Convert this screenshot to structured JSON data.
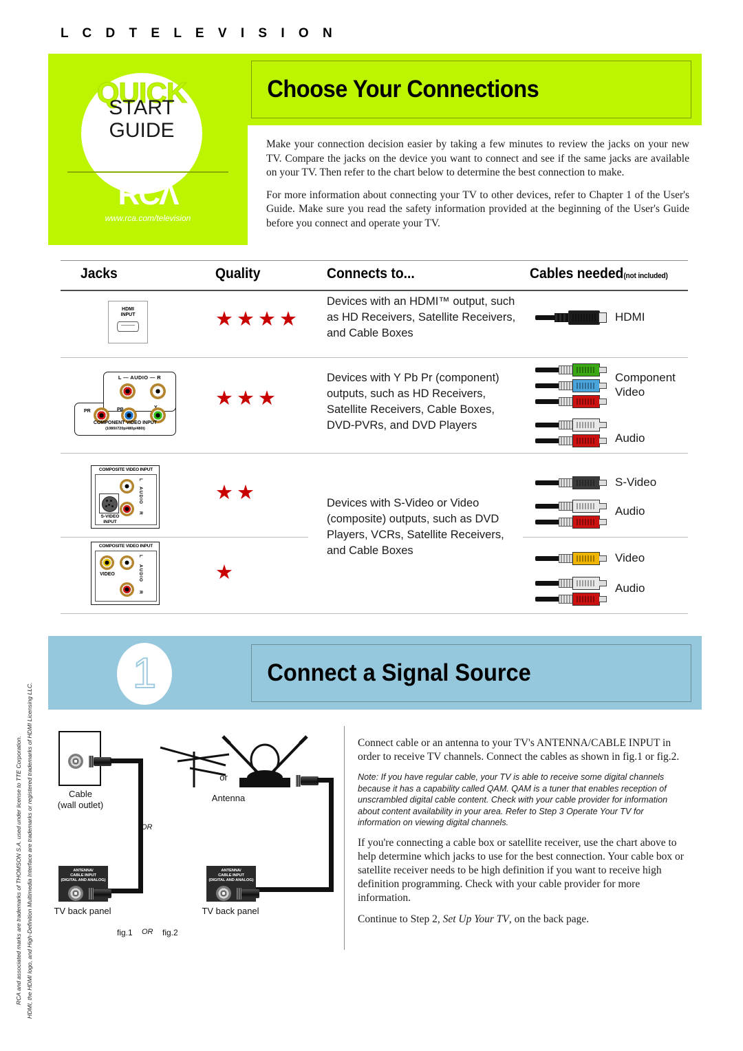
{
  "header": {
    "kicker": "L C D   T E L E V I S I O N",
    "brand": {
      "quick": "QUICK",
      "start": "START",
      "guide": "GUIDE",
      "logo": "RCΛ",
      "url": "www.rca.com/television"
    },
    "title": "Choose Your Connections"
  },
  "intro": {
    "p1": "Make your connection decision easier by taking a few minutes to review the jacks on your new TV. Compare the jacks on the device you want to connect and see if the same jacks are available on your TV. Then refer to the chart below to determine the best connection to make.",
    "p2": "For more information about connecting your TV to other devices, refer to Chapter 1 of the User's Guide. Make sure you read the safety information provided at the beginning of the User's Guide before you connect and operate your TV."
  },
  "table": {
    "headers": {
      "jacks": "Jacks",
      "quality": "Quality",
      "connects": "Connects to...",
      "cables": "Cables needed",
      "cables_note": "(not included)"
    },
    "rows": [
      {
        "jack_type": "hdmi",
        "jack_labels": {
          "line1": "HDMI",
          "line2": "INPUT"
        },
        "stars": 4,
        "connects": "Devices with an HDMI™ output, such as HD Receivers, Satellite Receivers, and Cable Boxes",
        "cables": [
          {
            "label": "HDMI",
            "color": "#1c1c1c"
          }
        ]
      },
      {
        "jack_type": "component",
        "jack_labels": {
          "audio": "L — AUDIO — R",
          "title": "COMPONENT VIDEO INPUT",
          "sub": "(1080i/720p/480p/480i)",
          "pr": "PR",
          "pb": "PB",
          "y": "Y"
        },
        "stars": 3,
        "connects": "Devices with Y Pb Pr (component) outputs, such as HD Receivers, Satellite Receivers, Cable Boxes, DVD-PVRs, and DVD Players",
        "cables": [
          {
            "label": "Component Video",
            "color": "#3aa814"
          },
          {
            "label": "",
            "color": "#4aa5dd"
          },
          {
            "label": "",
            "color": "#cc1111"
          },
          {
            "label": "Audio",
            "color": "#e8e8e8"
          },
          {
            "label": "",
            "color": "#cc1111"
          }
        ]
      },
      {
        "jack_type": "svideo",
        "jack_labels": {
          "title": "COMPOSITE VIDEO INPUT",
          "svideo1": "S-VIDEO",
          "svideo2": "INPUT",
          "audio": "AUDIO",
          "l": "L",
          "r": "R"
        },
        "stars": 2,
        "connects": "Devices with S-Video or Video (composite) outputs, such as DVD Players, VCRs, Satellite Receivers, and Cable Boxes",
        "cables": [
          {
            "label": "S-Video",
            "color": "#3a3a3a"
          },
          {
            "label": "Audio",
            "color": "#e8e8e8"
          },
          {
            "label": "",
            "color": "#cc1111"
          }
        ]
      },
      {
        "jack_type": "composite",
        "jack_labels": {
          "title": "COMPOSITE VIDEO INPUT",
          "video": "VIDEO",
          "audio": "AUDIO",
          "l": "L",
          "r": "R"
        },
        "stars": 1,
        "connects": "",
        "cables": [
          {
            "label": "Video",
            "color": "#f0b500"
          },
          {
            "label": "Audio",
            "color": "#e8e8e8"
          },
          {
            "label": "",
            "color": "#cc1111"
          }
        ]
      }
    ]
  },
  "step": {
    "number": "1",
    "title": "Connect a Signal Source",
    "p1": "Connect cable or an antenna to your TV's ANTENNA/CABLE INPUT in order to receive TV channels. Connect the cables as shown in fig.1 or fig.2.",
    "note": "Note: If you have regular cable, your TV is able to receive some digital channels because it has a capability called QAM. QAM is a tuner that enables reception of unscrambled digital cable content. Check with your cable provider for information about content availability in your area. Refer to Step 3 Operate Your TV for information on viewing digital channels.",
    "p2": "If you're connecting a cable box or satellite receiver, use the chart above to help determine which jacks to use for the best connection. Your cable box or satellite receiver needs to be high definition if you want to receive high definition programming. Check with your cable provider for more information.",
    "p3_pre": "Continue to Step 2, ",
    "p3_em": "Set Up Your TV",
    "p3_post": ", on the back page."
  },
  "diagram": {
    "cable_label_l1": "Cable",
    "cable_label_l2": "(wall outlet)",
    "antenna_label": "Antenna",
    "or_small": "or",
    "or_mid": "OR",
    "tv_panel_1": "TV back panel",
    "tv_panel_2": "TV back panel",
    "panel_text_l1": "ANTENNA/",
    "panel_text_l2": "CABLE INPUT",
    "panel_text_l3": "(DIGITAL AND ANALOG)",
    "fig1": "fig.1",
    "fig_or": "OR",
    "fig2": "fig.2"
  },
  "legal": {
    "line1": "RCA and associated marks are trademarks of THOMSON S.A. used under license to TTE Corporation.",
    "line2": "HDMI, the HDMI logo, and High-Definition Multimedia Interface are trademarks or registered trademarks of HDMI Licensing LLC."
  },
  "colors": {
    "green": "#bdf400",
    "blue": "#95c8dd",
    "star_red": "#c80000"
  }
}
